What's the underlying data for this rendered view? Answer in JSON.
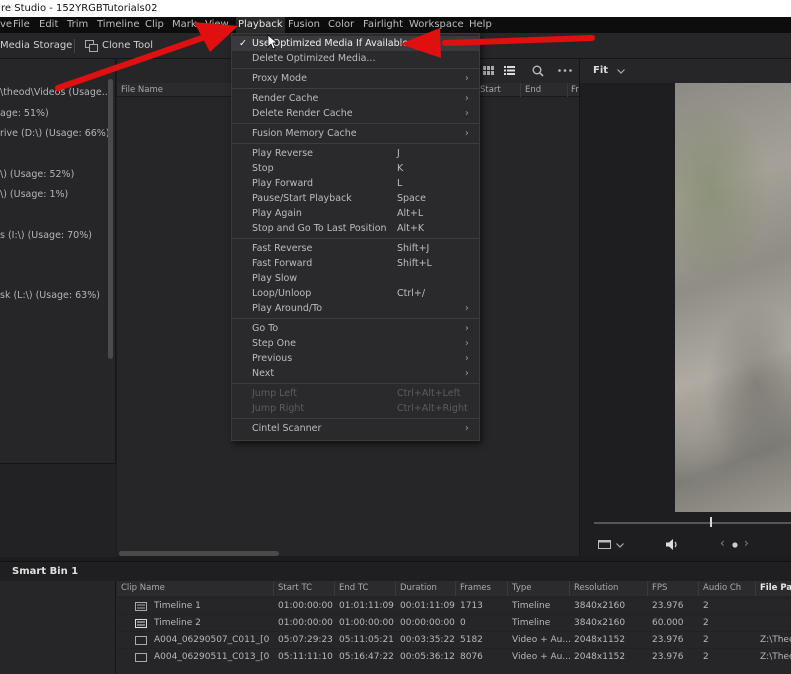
{
  "window": {
    "title": "re Studio - 152YRGBTutorials02"
  },
  "menubar": {
    "items": [
      "ve",
      "File",
      "Edit",
      "Trim",
      "Timeline",
      "Clip",
      "Mark",
      "View",
      "Playback",
      "Fusion",
      "Color",
      "Fairlight",
      "Workspace",
      "Help"
    ],
    "active": "Playback"
  },
  "toolbar": {
    "media_storage": "Media Storage",
    "clone_tool": "Clone Tool"
  },
  "left_panel": {
    "volumes": [
      "\\theod\\Videos (Usage...",
      "age: 51%)",
      "rive (D:\\) (Usage: 66%)",
      "\\) (Usage: 52%)",
      "\\) (Usage: 1%)",
      "s (I:\\) (Usage: 70%)",
      "sk (L:\\) (Usage: 63%)"
    ]
  },
  "file_panel": {
    "columns": [
      "File Name",
      "Start",
      "End",
      "Fr"
    ]
  },
  "viewer": {
    "zoom": "Fit"
  },
  "playback_menu": {
    "items": [
      {
        "label": "Use Optimized Media If Available",
        "shortcut": "",
        "checked": true,
        "highlighted": true
      },
      {
        "label": "Delete Optimized Media...",
        "shortcut": "",
        "disabled": false
      },
      {
        "label": "Proxy Mode",
        "submenu": true
      },
      {
        "label": "Render Cache",
        "submenu": true
      },
      {
        "label": "Delete Render Cache",
        "submenu": true
      },
      {
        "label": "Fusion Memory Cache",
        "submenu": true
      },
      {
        "label": "Play Reverse",
        "shortcut": "J"
      },
      {
        "label": "Stop",
        "shortcut": "K"
      },
      {
        "label": "Play Forward",
        "shortcut": "L"
      },
      {
        "label": "Pause/Start Playback",
        "shortcut": "Space"
      },
      {
        "label": "Play Again",
        "shortcut": "Alt+L"
      },
      {
        "label": "Stop and Go To Last Position",
        "shortcut": "Alt+K"
      },
      {
        "label": "Fast Reverse",
        "shortcut": "Shift+J"
      },
      {
        "label": "Fast Forward",
        "shortcut": "Shift+L"
      },
      {
        "label": "Play Slow",
        "shortcut": ""
      },
      {
        "label": "Loop/Unloop",
        "shortcut": "Ctrl+/"
      },
      {
        "label": "Play Around/To",
        "submenu": true
      },
      {
        "label": "Go To",
        "submenu": true
      },
      {
        "label": "Step One",
        "submenu": true
      },
      {
        "label": "Previous",
        "submenu": true
      },
      {
        "label": "Next",
        "submenu": true
      },
      {
        "label": "Jump Left",
        "shortcut": "Ctrl+Alt+Left",
        "disabled": true
      },
      {
        "label": "Jump Right",
        "shortcut": "Ctrl+Alt+Right",
        "disabled": true
      },
      {
        "label": "Cintel Scanner",
        "submenu": true
      }
    ]
  },
  "bin": {
    "title": "Smart Bin 1"
  },
  "clip_table": {
    "columns": [
      "Clip Name",
      "Start TC",
      "End TC",
      "Duration",
      "Frames",
      "Type",
      "Resolution",
      "FPS",
      "Audio Ch",
      "File Path"
    ],
    "rows": [
      [
        "Timeline 1",
        "01:00:00:00",
        "01:01:11:09",
        "00:01:11:09",
        "1713",
        "Timeline",
        "3840x2160",
        "23.976",
        "2",
        ""
      ],
      [
        "Timeline 2",
        "01:00:00:00",
        "01:00:00:00",
        "00:00:00:00",
        "0",
        "Timeline",
        "3840x2160",
        "60.000",
        "2",
        ""
      ],
      [
        "A004_06290507_C011_[0...",
        "05:07:29:23",
        "05:11:05:21",
        "00:03:35:22",
        "5182",
        "Video + Au...",
        "2048x1152",
        "23.976",
        "2",
        "Z:\\Thec"
      ],
      [
        "A004_06290511_C013_[0...",
        "05:11:11:10",
        "05:16:47:22",
        "00:05:36:12",
        "8076",
        "Video + Au...",
        "2048x1152",
        "23.976",
        "2",
        "Z:\\Thec"
      ]
    ]
  },
  "colors": {
    "annotation_arrow": "#e01010",
    "menu_bg": "#2a2a2c",
    "app_bg": "#262628"
  }
}
